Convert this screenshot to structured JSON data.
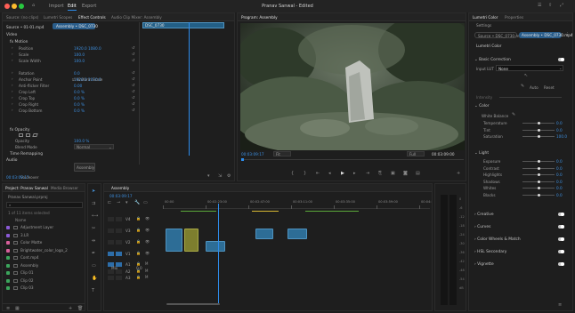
{
  "topbar": {
    "nav": [
      "Import",
      "Edit",
      "Export"
    ],
    "title": "Pranav Sanwal - Edited"
  },
  "effect_controls": {
    "tabs": [
      "Source: (no clips)",
      "Lumetri Scopes",
      "Effect Controls",
      "Audio Clip Mixer: Assembly"
    ],
    "source_label": "Source • 01-01.mp4",
    "sequence_label": "Assembly • DSC_0730",
    "clip_tag": "DSC_0730",
    "section_video": "Video",
    "motion": "Motion",
    "rows": [
      {
        "label": "Position",
        "value": "1920.0  1080.0"
      },
      {
        "label": "Scale",
        "value": "100.0"
      },
      {
        "label": "Scale Width",
        "value": "100.0"
      },
      {
        "label": "",
        "value": ""
      },
      {
        "label": "Rotation",
        "value": "0.0"
      },
      {
        "label": "Anchor Point",
        "value": "1920.0  1080.0"
      },
      {
        "label": "Anti-flicker Filter",
        "value": "0.00"
      },
      {
        "label": "Crop Left",
        "value": "0.0 %"
      },
      {
        "label": "Crop Top",
        "value": "0.0 %"
      },
      {
        "label": "Crop Right",
        "value": "0.0 %"
      },
      {
        "label": "Crop Bottom",
        "value": "0.0 %"
      }
    ],
    "uniform_scale": "Uniform Scale",
    "opacity": "Opacity",
    "opacity_row": {
      "label": "Opacity",
      "value": "100.0 %"
    },
    "blend_mode": {
      "label": "Blend Mode",
      "value": "Normal"
    },
    "time_remapping": "Time Remapping",
    "audio": "Audio",
    "tag_sticker": "Assembly",
    "timecode": "00:03:09:17"
  },
  "program_monitor": {
    "tab": "Program: Assembly",
    "timecode_left": "00:03:09:17",
    "fit": "Fit",
    "full": "Full",
    "timecode_right": "00:03:09:00"
  },
  "lumetri": {
    "tabs": [
      "Lumetri Color",
      "Properties"
    ],
    "settings": "Settings",
    "source_chip": "Source • DSC_0730.mp4",
    "seq_chip": "Assembly • DSC_0730.mp4",
    "effect_name": "Lumetri Color",
    "basic": "Basic Correction",
    "input_lut_label": "Input LUT",
    "input_lut_value": "None",
    "auto": "Auto",
    "reset": "Reset",
    "intensity": "Intensity",
    "color": "Color",
    "white_balance": "White Balance",
    "sliders_color": [
      {
        "label": "Temperature",
        "value": "0.0",
        "pos": 0.5
      },
      {
        "label": "Tint",
        "value": "0.0",
        "pos": 0.5
      },
      {
        "label": "Saturation",
        "value": "100.0",
        "pos": 0.5
      }
    ],
    "light": "Light",
    "sliders_light": [
      {
        "label": "Exposure",
        "value": "0.0",
        "pos": 0.5
      },
      {
        "label": "Contrast",
        "value": "0.0",
        "pos": 0.5
      },
      {
        "label": "Highlights",
        "value": "0.0",
        "pos": 0.5
      },
      {
        "label": "Shadows",
        "value": "0.0",
        "pos": 0.5
      },
      {
        "label": "Whites",
        "value": "0.0",
        "pos": 0.5
      },
      {
        "label": "Blacks",
        "value": "0.0",
        "pos": 0.5
      }
    ],
    "sections": [
      "Creative",
      "Curves",
      "Color Wheels & Match",
      "HSL Secondary",
      "Vignette"
    ]
  },
  "project": {
    "tabs": [
      "Project: Pranav Sanwal",
      "Media Browser"
    ],
    "file": "Pranav Sanwal.prproj",
    "count": "1 of 11 items selected",
    "col_name": "Name",
    "items": [
      {
        "name": "Adjustment Layer",
        "color": "#8b5ad6"
      },
      {
        "name": "3.LR",
        "color": "#8b5ad6"
      },
      {
        "name": "Color Matte",
        "color": "#d85f9c"
      },
      {
        "name": "Brightwater_color_logo_2",
        "color": "#d85f9c"
      },
      {
        "name": "Cont.mp4",
        "color": "#3ba55c"
      },
      {
        "name": "Assembly",
        "color": "#3ba55c"
      },
      {
        "name": "Clip 01",
        "color": "#3ba55c"
      },
      {
        "name": "Clip 02",
        "color": "#3ba55c"
      },
      {
        "name": "Clip 03",
        "color": "#3ba55c"
      }
    ]
  },
  "timeline": {
    "tab": "Assembly",
    "timecode": "00:03:09:17",
    "ruler": [
      "00:00",
      "00:02:23:00",
      "00:02:47:00",
      "00:03:11:00",
      "00:03:35:00",
      "00:03:59:00",
      "00:04:23:00"
    ],
    "tracks": [
      "V4",
      "V3",
      "V2",
      "V1",
      "A1",
      "A2",
      "A3"
    ],
    "mix": "Mix",
    "mix_value": "0.0"
  },
  "colors": {
    "accent": "#2d8ceb",
    "clip_cyan": "#2d6d96",
    "clip_yellow": "#7d7e2e"
  }
}
